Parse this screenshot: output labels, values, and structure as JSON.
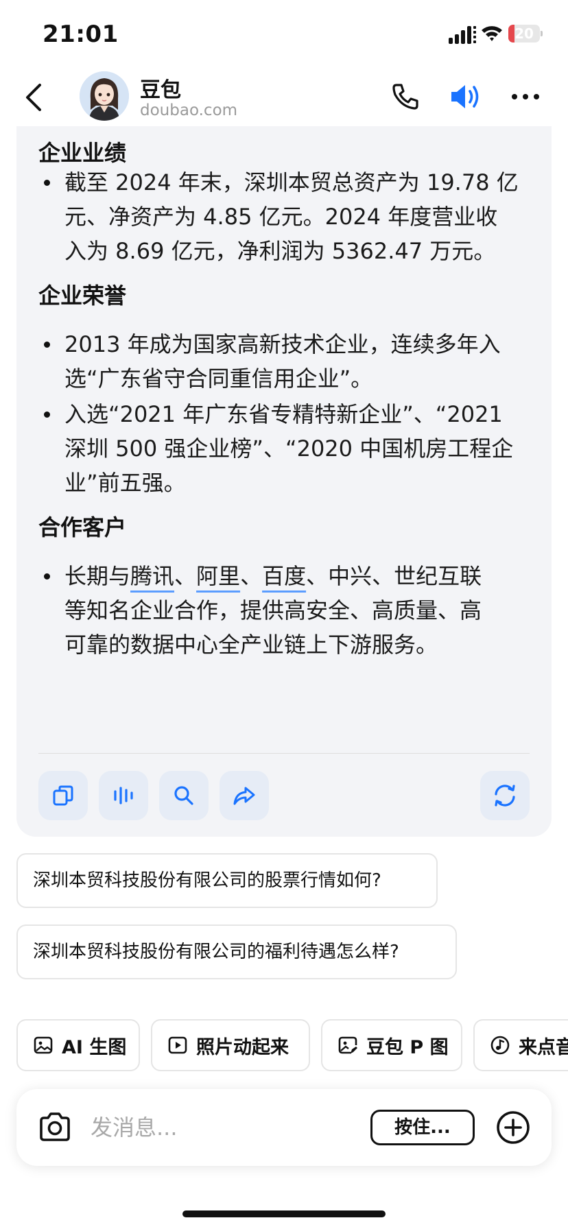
{
  "status_bar": {
    "time": "21:01",
    "battery_level": "20",
    "battery_fraction": 0.2,
    "battery_color": "#e5484d"
  },
  "header": {
    "name": "豆包",
    "domain": "doubao.com",
    "icons": [
      "back-icon",
      "phone-icon",
      "speaker-icon",
      "more-icon"
    ],
    "accent_color": "#1a73ff"
  },
  "message": {
    "sections": [
      {
        "title": "企业业绩",
        "bullets": [
          [
            "截至 2024 年末，深圳本贸总资产为 19.78 亿",
            "元、净资产为 4.85 亿元。2024 年度营业收",
            "入为 8.69 亿元，净利润为 5362.47 万元。"
          ]
        ]
      },
      {
        "title": "企业荣誉",
        "bullets": [
          [
            "2013 年成为国家高新技术企业，连续多年入",
            "选“广东省守合同重信用企业”。"
          ],
          [
            "入选“2021 年广东省专精特新企业”、“2021",
            "深圳 500 强企业榜”、“2020 中国机房工程企",
            "业”前五强。"
          ]
        ]
      },
      {
        "title": "合作客户",
        "bullet_parts": {
          "prefix": "长期与",
          "link1": "腾讯",
          "sep1": "、",
          "link2": "阿里",
          "sep2": "、",
          "link3": "百度",
          "rest1": "、中兴、世纪互联",
          "line2": "等知名企业合作，提供高安全、高质量、高",
          "line3": "可靠的数据中心全产业链上下游服务。"
        }
      }
    ],
    "actions": [
      "copy-icon",
      "voice-icon",
      "search-icon",
      "share-icon",
      "regenerate-icon"
    ]
  },
  "suggestions": [
    "深圳本贸科技股份有限公司的股票行情如何?",
    "深圳本贸科技股份有限公司的福利待遇怎么样?"
  ],
  "shortcuts": [
    {
      "label": "AI 生图",
      "icon": "image-icon"
    },
    {
      "label": "照片动起来",
      "icon": "play-icon"
    },
    {
      "label": "豆包 P 图",
      "icon": "edit-image-icon"
    },
    {
      "label": "来点音",
      "icon": "music-icon"
    }
  ],
  "input": {
    "placeholder": "发消息...",
    "hold_label": "按住..."
  }
}
